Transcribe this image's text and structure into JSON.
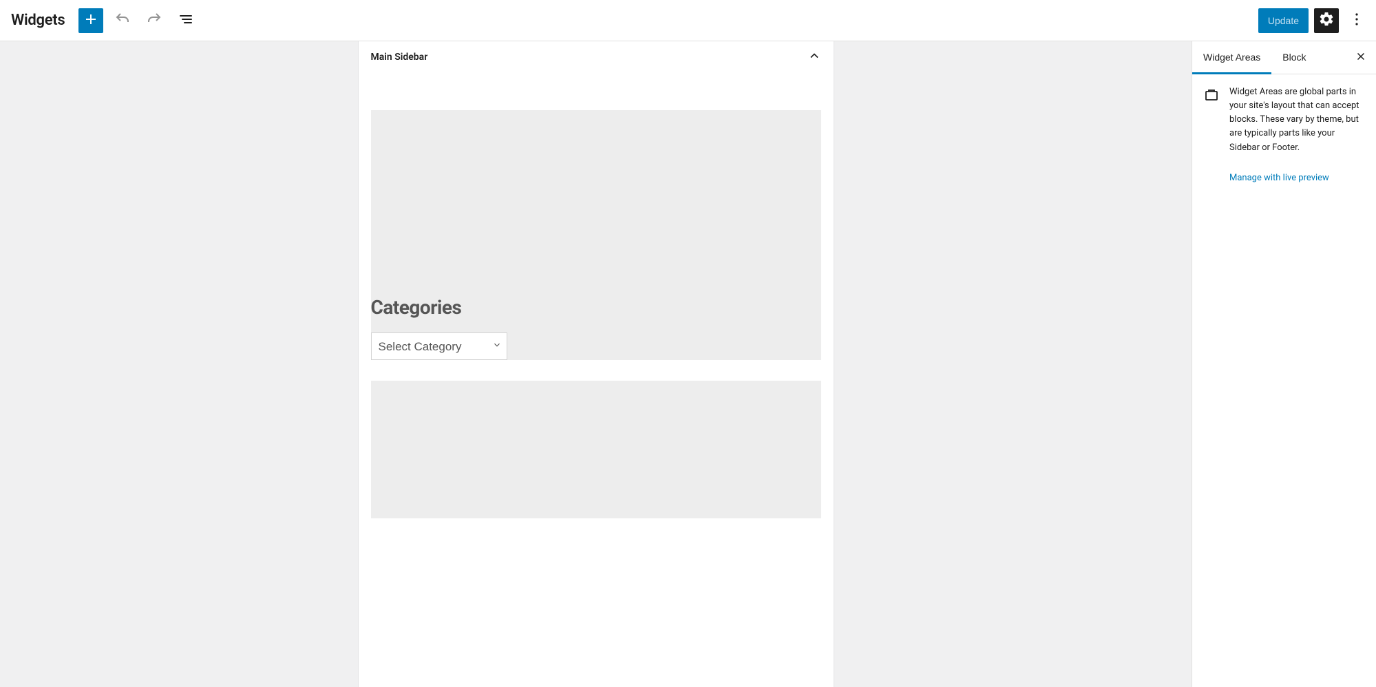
{
  "header": {
    "page_title": "Widgets",
    "update_label": "Update"
  },
  "canvas": {
    "area_title": "Main Sidebar",
    "categories_heading": "Categories",
    "category_select_value": "Select Category",
    "category_options": [
      "Select Category"
    ]
  },
  "sidebar": {
    "tabs": {
      "widget_areas": "Widget Areas",
      "block": "Block"
    },
    "description": "Widget Areas are global parts in your site's layout that can accept blocks. These vary by theme, but are typically parts like your Sidebar or Footer.",
    "manage_link": "Manage with live preview"
  }
}
